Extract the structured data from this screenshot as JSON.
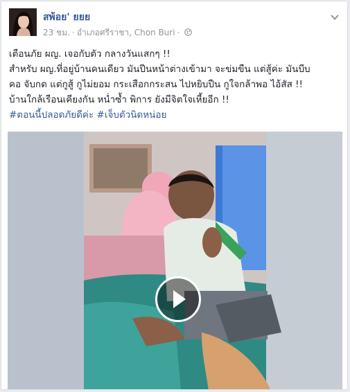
{
  "post": {
    "author": "สพ้อย' ยยย",
    "time": "23 ชม.",
    "location": "อำเภอศรีราชา, Chon Buri",
    "separator": "·",
    "lines": [
      "เตือนภัย ผญ. เจอกับตัว กลางวันแสกๆ !!",
      "สำหรับ ผญ.ที่อยู่บ้านคนเดียว มันปีนหน้าต่างเข้ามา จะข่มขืน แต่สู้ค่ะ มันบีบ",
      "คอ จับกด แต่กูสู้ กูไม่ยอม กระเสือกกระสน ไปหยิบปืน กูใจกล้าพอ ไอ้สัส !!",
      "บ้านใกล้เรือนเคียงกัน หน่ำซ้ำ พิการ ยังมีจิตใจเหี้ยอีก !!"
    ],
    "hashtags": [
      "#ตอนนี้ปลอดภัยดีค่ะ",
      "#เจ็บตัวนิดหน่อย"
    ]
  },
  "icons": {
    "globe": "globe-icon",
    "chevron": "chevron-down-icon",
    "play": "play-icon"
  },
  "colors": {
    "link": "#365899",
    "meta": "#90949c",
    "text": "#1d2129",
    "background": "#e9ebee"
  }
}
